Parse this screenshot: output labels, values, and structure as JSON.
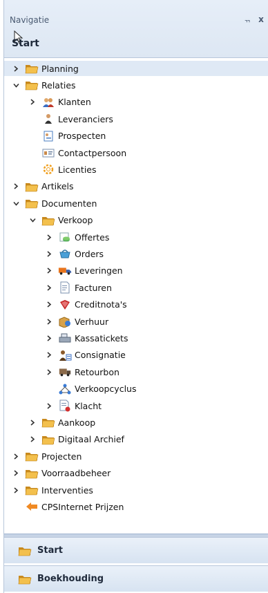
{
  "panel": {
    "title": "Navigatie",
    "pin_glyph": "ᆩ",
    "close_glyph": "x",
    "section_header": "Start"
  },
  "tree": [
    {
      "label": "Planning",
      "icon": "folder-icon",
      "depth": 0,
      "expander": "collapsed",
      "selected": true
    },
    {
      "label": "Relaties",
      "icon": "folder-icon",
      "depth": 0,
      "expander": "expanded"
    },
    {
      "label": "Klanten",
      "icon": "customers-icon",
      "depth": 1,
      "expander": "collapsed"
    },
    {
      "label": "Leveranciers",
      "icon": "supplier-person-icon",
      "depth": 1,
      "expander": "none"
    },
    {
      "label": "Prospecten",
      "icon": "prospect-card-icon",
      "depth": 1,
      "expander": "none"
    },
    {
      "label": "Contactpersoon",
      "icon": "contact-card-icon",
      "depth": 1,
      "expander": "none"
    },
    {
      "label": "Licenties",
      "icon": "license-gear-icon",
      "depth": 1,
      "expander": "none"
    },
    {
      "label": "Artikels",
      "icon": "folder-icon",
      "depth": 0,
      "expander": "collapsed"
    },
    {
      "label": "Documenten",
      "icon": "folder-icon",
      "depth": 0,
      "expander": "expanded"
    },
    {
      "label": "Verkoop",
      "icon": "folder-icon",
      "depth": 1,
      "expander": "expanded"
    },
    {
      "label": "Offertes",
      "icon": "quote-money-icon",
      "depth": 2,
      "expander": "collapsed"
    },
    {
      "label": "Orders",
      "icon": "basket-icon",
      "depth": 2,
      "expander": "collapsed"
    },
    {
      "label": "Leveringen",
      "icon": "truck-icon",
      "depth": 2,
      "expander": "collapsed"
    },
    {
      "label": "Facturen",
      "icon": "invoice-icon",
      "depth": 2,
      "expander": "collapsed"
    },
    {
      "label": "Creditnota's",
      "icon": "credit-note-icon",
      "depth": 2,
      "expander": "collapsed"
    },
    {
      "label": "Verhuur",
      "icon": "rental-box-icon",
      "depth": 2,
      "expander": "collapsed"
    },
    {
      "label": "Kassatickets",
      "icon": "cash-register-icon",
      "depth": 2,
      "expander": "collapsed"
    },
    {
      "label": "Consignatie",
      "icon": "consignment-icon",
      "depth": 2,
      "expander": "collapsed"
    },
    {
      "label": "Retourbon",
      "icon": "return-truck-icon",
      "depth": 2,
      "expander": "collapsed"
    },
    {
      "label": "Verkoopcyclus",
      "icon": "sales-cycle-icon",
      "depth": 2,
      "expander": "none"
    },
    {
      "label": "Klacht",
      "icon": "complaint-doc-icon",
      "depth": 2,
      "expander": "collapsed"
    },
    {
      "label": "Aankoop",
      "icon": "folder-icon",
      "depth": 1,
      "expander": "collapsed"
    },
    {
      "label": "Digitaal Archief",
      "icon": "folder-icon",
      "depth": 1,
      "expander": "collapsed"
    },
    {
      "label": "Projecten",
      "icon": "folder-icon",
      "depth": 0,
      "expander": "collapsed"
    },
    {
      "label": "Voorraadbeheer",
      "icon": "folder-icon",
      "depth": 0,
      "expander": "collapsed"
    },
    {
      "label": "Interventies",
      "icon": "folder-icon",
      "depth": 0,
      "expander": "collapsed"
    },
    {
      "label": "CPSInternet Prijzen",
      "icon": "internet-prices-icon",
      "depth": 0,
      "expander": "none"
    }
  ],
  "bottom_buttons": [
    {
      "label": "Start",
      "icon": "folder-icon"
    },
    {
      "label": "Boekhouding",
      "icon": "folder-icon"
    }
  ],
  "colors": {
    "folder": "#f0b43c",
    "folder_dark": "#c98a1e",
    "selected_row": "#dfe9f5",
    "titlebar": "#e6eef8"
  }
}
